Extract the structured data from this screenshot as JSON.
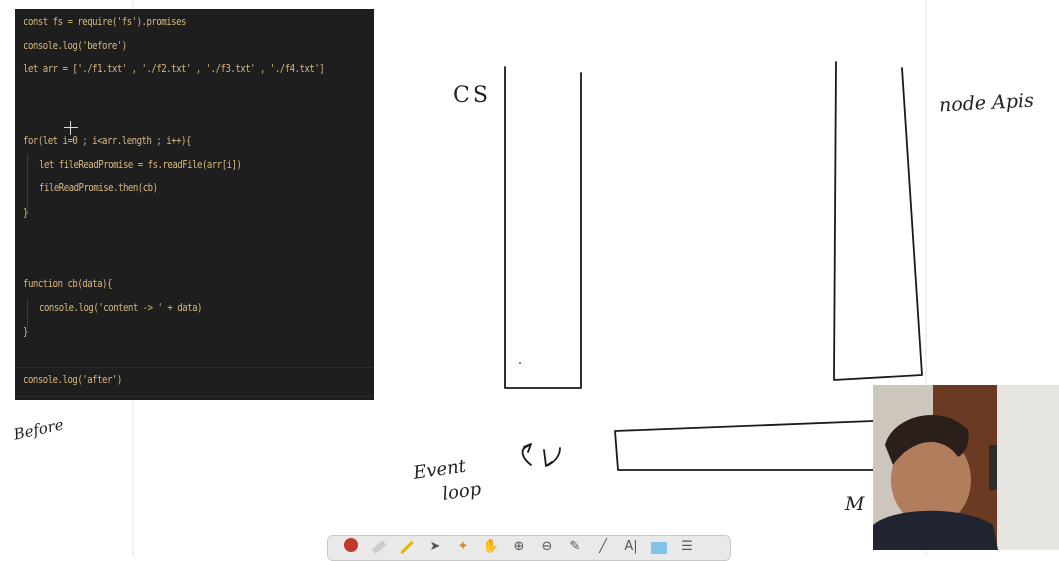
{
  "editor": {
    "lines": [
      "const fs = require('fs').promises",
      "console.log('before')",
      "let arr = ['./f1.txt' , './f2.txt' , './f3.txt' , './f4.txt']",
      "for(let i=0 ; i<arr.length ; i++){",
      "let fileReadPromise = fs.readFile(arr[i])",
      "fileReadPromise.then(cb)",
      "}",
      "function cb(data){",
      "console.log('content -> ' + data)",
      "}",
      "console.log('after')"
    ]
  },
  "whiteboard": {
    "label_cs": "CS",
    "label_node_apis": "node Apis",
    "label_before": "Before",
    "label_event": "Event",
    "label_loop": "loop",
    "label_m": "M"
  },
  "toolbar": {
    "tools": [
      "pen-tool",
      "highlighter-tool",
      "marker-tool",
      "pointer-tool",
      "laser-tool",
      "hand-tool",
      "zoom-in-tool",
      "zoom-out-tool",
      "eraser-tool",
      "line-tool",
      "text-tool",
      "color-tool",
      "more-tool"
    ],
    "text_tool_label": "A|"
  },
  "colors": {
    "code_bg": "#1e1e1e",
    "code_text": "#d7ba7d",
    "ink": "#222222"
  }
}
